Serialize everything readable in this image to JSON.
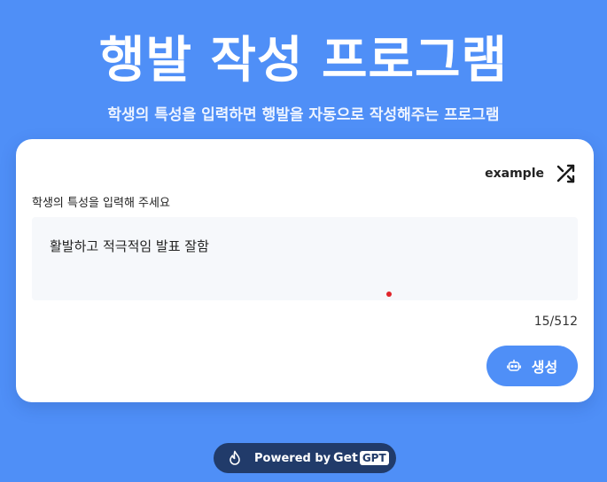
{
  "header": {
    "title": "행발 작성 프로그램",
    "subtitle": "학생의 특성을 입력하면 행발을 자동으로 작성해주는 프로그램"
  },
  "card": {
    "example_label": "example",
    "example_icon": "shuffle-icon",
    "field_label": "학생의 특성을 입력해 주세요",
    "input_value": "활발하고 적극적임 발표 잘함",
    "counter": "15/512",
    "generate_button_label": "생성",
    "generate_button_icon": "robot-icon"
  },
  "footer": {
    "powered_by": "Powered by",
    "brand_get": "Get",
    "brand_gpt": "GPT",
    "icon": "flame-icon"
  },
  "colors": {
    "background": "#4f8ff7",
    "card": "#ffffff",
    "accent": "#4f8ff7",
    "footer_pill": "#213b6a",
    "input_bg": "#f6f8fb"
  }
}
